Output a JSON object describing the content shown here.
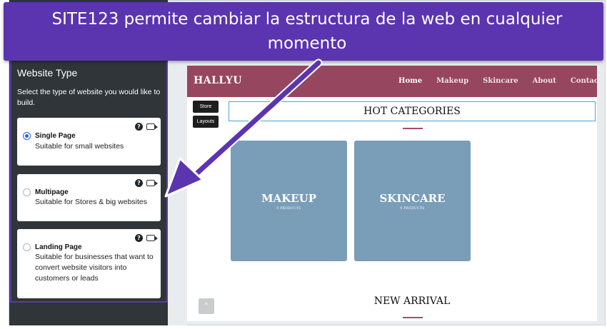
{
  "banner": {
    "text": "SITE123 permite cambiar la estructura de la web en cualquier momento"
  },
  "sidebar": {
    "title": "Website Type",
    "description": "Select the type of website you would like to build.",
    "options": [
      {
        "name": "Single Page",
        "description": "Suitable for small websites",
        "selected": true
      },
      {
        "name": "Multipage",
        "description": "Suitable for Stores & big websites",
        "selected": false
      },
      {
        "name": "Landing Page",
        "description": "Suitable for businesses that want to convert website visitors into customers or leads",
        "selected": false
      }
    ]
  },
  "preview": {
    "logo": "HALLYU",
    "nav": [
      "Home",
      "Makeup",
      "Skincare",
      "About",
      "Contact"
    ],
    "active_nav": "Home",
    "side_buttons": [
      "Store",
      "Layouts"
    ],
    "section_title": "HOT CATEGORIES",
    "categories": [
      {
        "name": "MAKEUP",
        "count": "0 PRODUCTS"
      },
      {
        "name": "SKINCARE",
        "count": "0 PRODUCTS"
      }
    ],
    "scroll_top_icon": "^",
    "next_section_title": "NEW ARRIVAL"
  },
  "colors": {
    "banner": "#5b34b0",
    "sidebar": "#2f3538",
    "nav": "#96465f",
    "tile": "#7a9db8",
    "accent": "#a84b65",
    "radio_selected": "#2563eb"
  }
}
